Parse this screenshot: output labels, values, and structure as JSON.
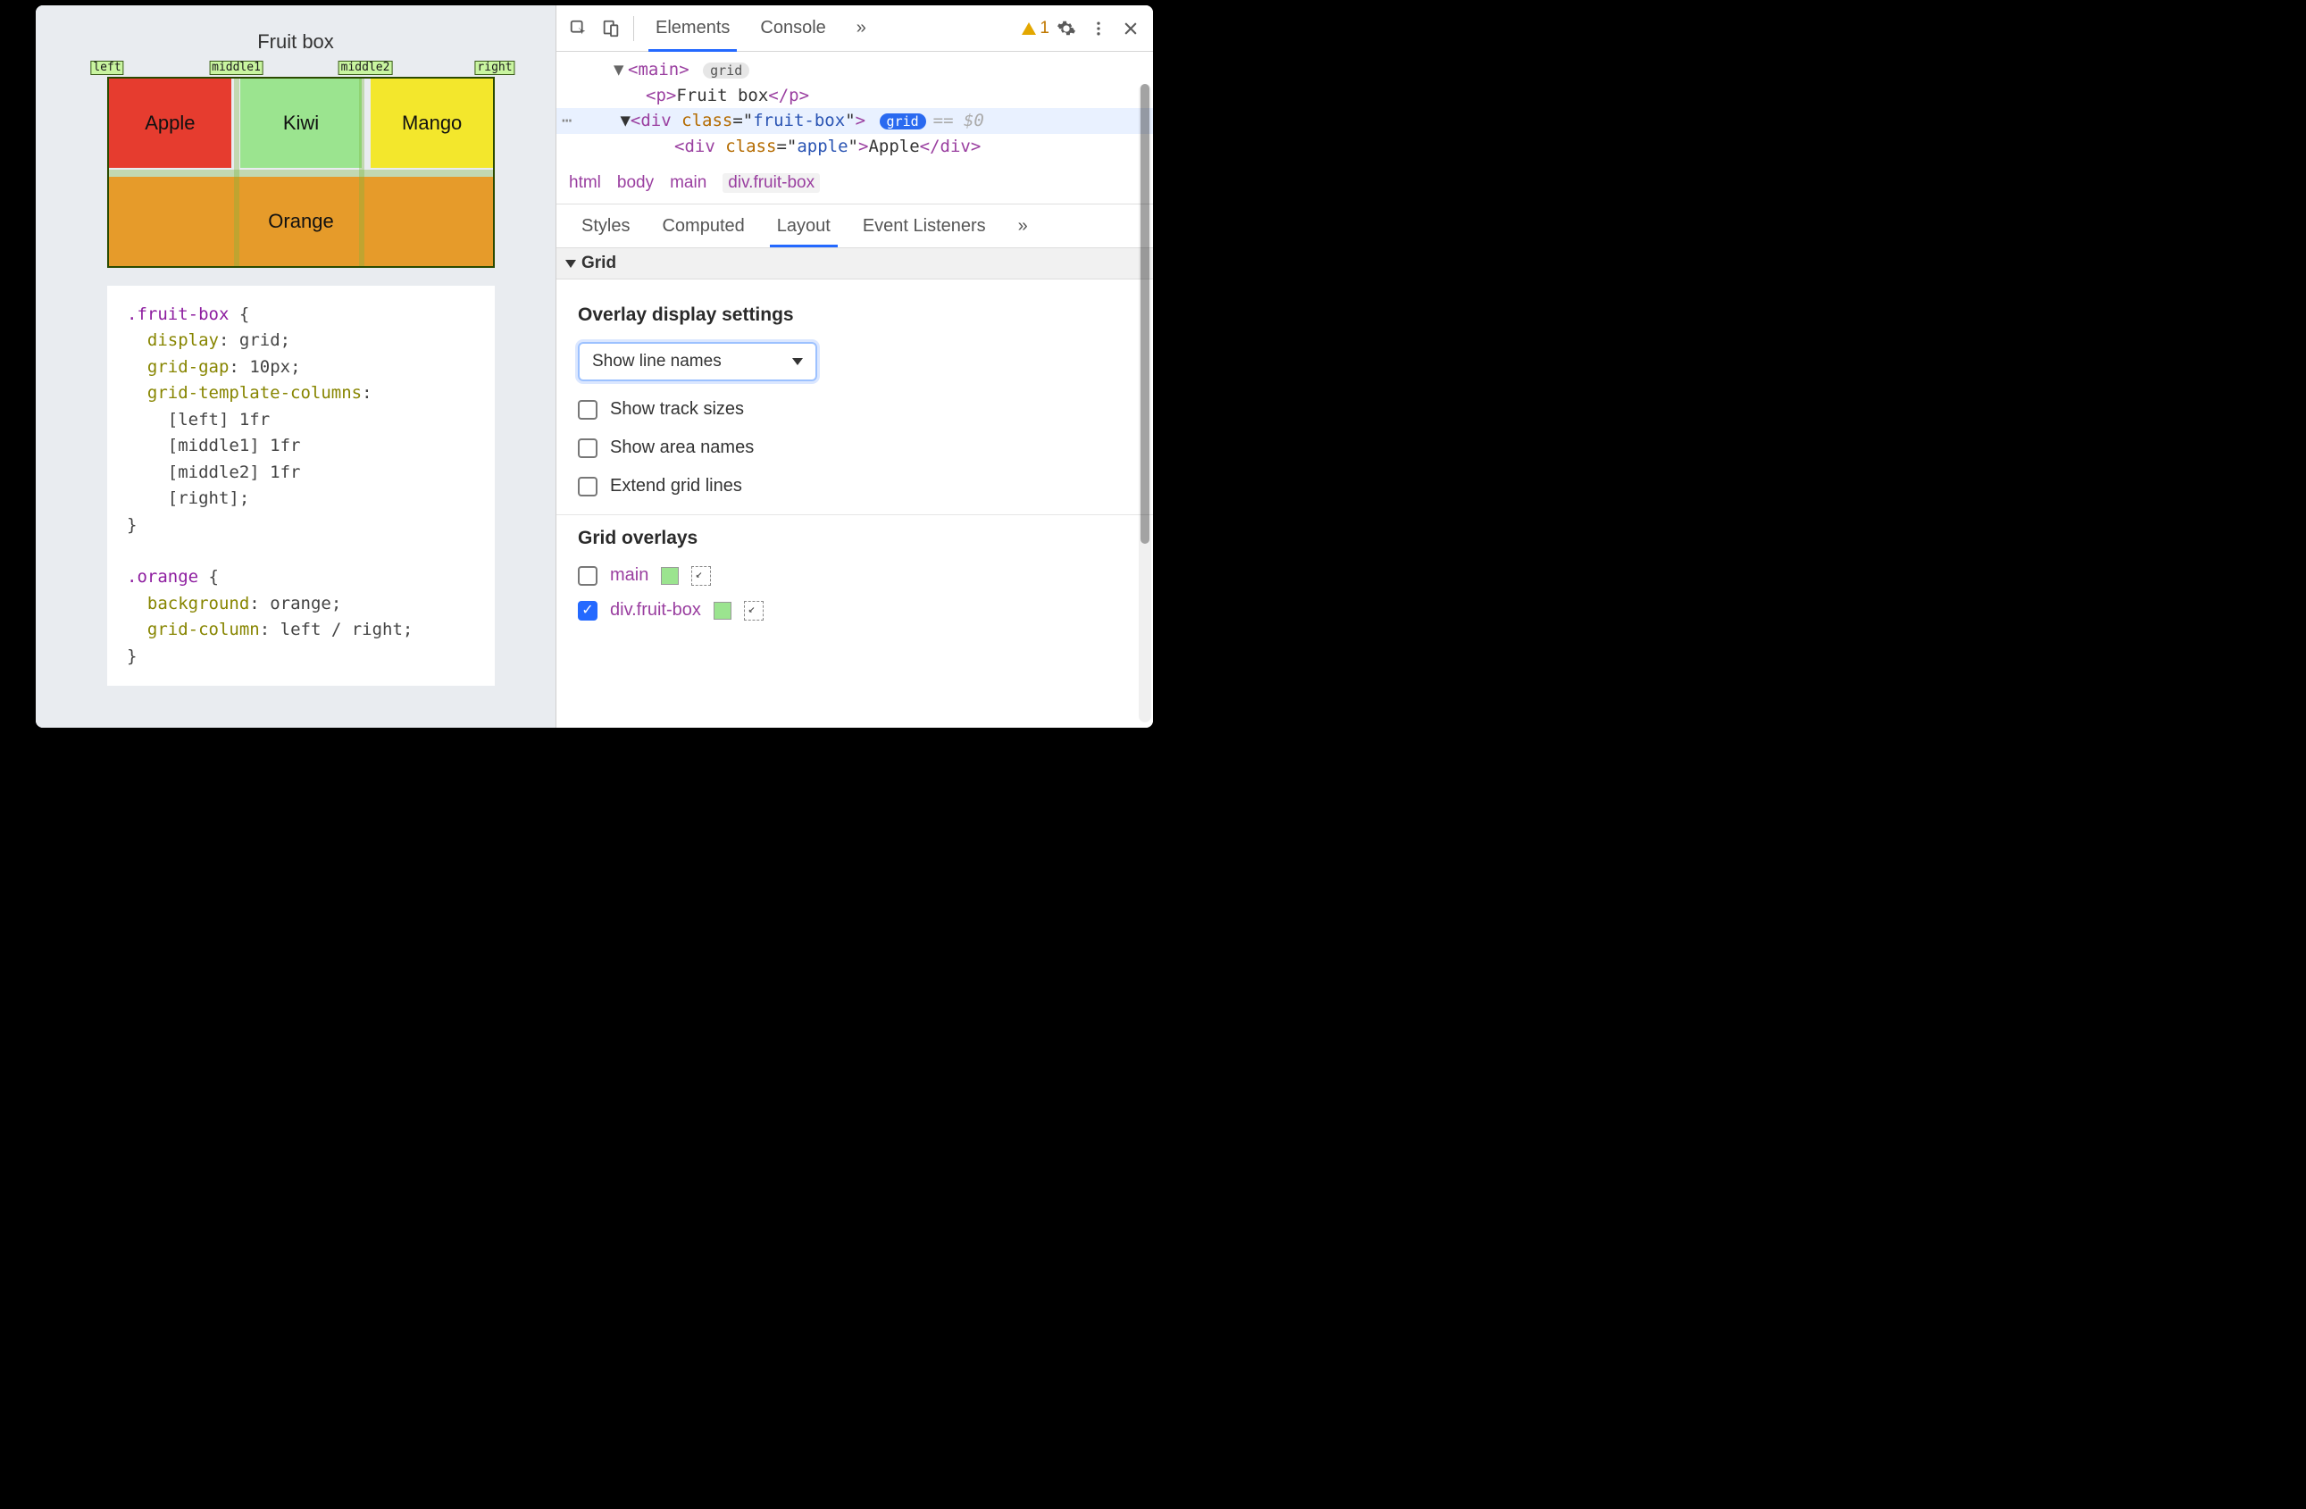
{
  "preview": {
    "title": "Fruit box",
    "line_names": [
      "left",
      "middle1",
      "middle2",
      "right"
    ],
    "cells": {
      "apple": "Apple",
      "kiwi": "Kiwi",
      "mango": "Mango",
      "orange": "Orange"
    }
  },
  "code": {
    "sel_fruitbox": ".fruit-box",
    "open": " {",
    "close": "}",
    "prop_display": "display",
    "val_display": "grid",
    "prop_gridgap": "grid-gap",
    "val_gridgap": "10px",
    "prop_gtc": "grid-template-columns",
    "gtc_l1": "[left] 1fr",
    "gtc_l2": "[middle1] 1fr",
    "gtc_l3": "[middle2] 1fr",
    "gtc_l4": "[right]",
    "sel_orange": ".orange",
    "prop_bg": "background",
    "val_bg": "orange",
    "prop_gc": "grid-column",
    "val_gc": "left / right",
    "semi": ";",
    "colon": ":"
  },
  "devtools": {
    "tabs": {
      "elements": "Elements",
      "console": "Console",
      "more": "»"
    },
    "warn_count": "1",
    "dom": {
      "main_tag": "main",
      "grid_pill": "grid",
      "p_open": "<p>",
      "p_text": "Fruit box",
      "p_close": "</p>",
      "div": "div",
      "class_attr": "class",
      "fruitbox_val": "fruit-box",
      "eq0": "== $0",
      "apple_val": "apple",
      "apple_text": "Apple"
    },
    "breadcrumbs": [
      "html",
      "body",
      "main",
      "div.fruit-box"
    ],
    "panel_tabs": {
      "styles": "Styles",
      "computed": "Computed",
      "layout": "Layout",
      "listeners": "Event Listeners",
      "more": "»"
    },
    "grid_section": "Grid",
    "overlay_settings_label": "Overlay display settings",
    "select_label": "Show line names",
    "check_track_sizes": "Show track sizes",
    "check_area_names": "Show area names",
    "check_extend_lines": "Extend grid lines",
    "grid_overlays_label": "Grid overlays",
    "overlay_main": "main",
    "overlay_fruitbox": "div.fruit-box"
  }
}
